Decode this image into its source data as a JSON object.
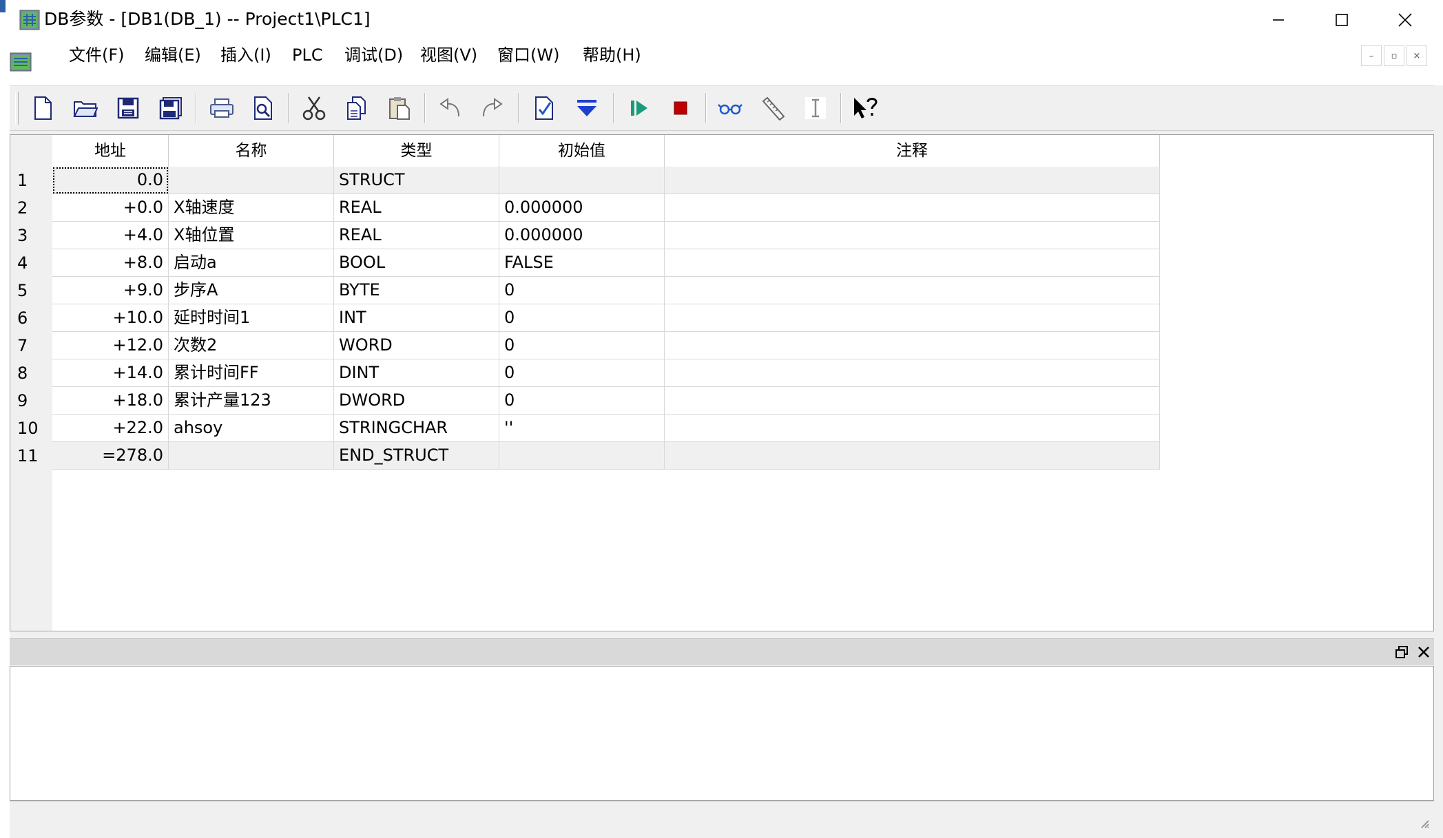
{
  "window": {
    "title": "DB参数 - [DB1(DB_1) -- Project1\\PLC1]",
    "controls": [
      "minimize",
      "maximize",
      "close"
    ]
  },
  "menu": {
    "items": [
      {
        "label": "文件(F)"
      },
      {
        "label": "编辑(E)"
      },
      {
        "label": "插入(I)"
      },
      {
        "label": "PLC"
      },
      {
        "label": "调试(D)"
      },
      {
        "label": "视图(V)"
      },
      {
        "label": "窗口(W)"
      },
      {
        "label": "帮助(H)"
      }
    ],
    "mdi_controls": [
      "–",
      "▫",
      "×"
    ]
  },
  "toolbar": {
    "icons": [
      "new-file-icon",
      "open-folder-icon",
      "save-icon",
      "save-all-icon",
      "print-icon",
      "print-preview-icon",
      "cut-icon",
      "copy-icon",
      "paste-icon",
      "undo-icon",
      "redo-icon",
      "check-icon",
      "download-icon",
      "run-icon",
      "stop-icon",
      "monitor-glasses-icon",
      "ruler-icon",
      "text-cursor-icon",
      "context-help-icon"
    ]
  },
  "grid": {
    "columns": [
      "地址",
      "名称",
      "类型",
      "初始值",
      "注释"
    ],
    "rows": [
      {
        "num": "1",
        "addr": "0.0",
        "name": "",
        "type": "STRUCT",
        "init": "",
        "comment": "",
        "shaded": true
      },
      {
        "num": "2",
        "addr": "+0.0",
        "name": "X轴速度",
        "type": "REAL",
        "init": "0.000000",
        "comment": ""
      },
      {
        "num": "3",
        "addr": "+4.0",
        "name": "X轴位置",
        "type": "REAL",
        "init": "0.000000",
        "comment": ""
      },
      {
        "num": "4",
        "addr": "+8.0",
        "name": "启动a",
        "type": "BOOL",
        "init": "FALSE",
        "comment": ""
      },
      {
        "num": "5",
        "addr": "+9.0",
        "name": "步序A",
        "type": "BYTE",
        "init": "0",
        "comment": ""
      },
      {
        "num": "6",
        "addr": "+10.0",
        "name": "延时时间1",
        "type": "INT",
        "init": "0",
        "comment": ""
      },
      {
        "num": "7",
        "addr": "+12.0",
        "name": "次数2",
        "type": "WORD",
        "init": "0",
        "comment": ""
      },
      {
        "num": "8",
        "addr": "+14.0",
        "name": "累计时间FF",
        "type": "DINT",
        "init": "0",
        "comment": ""
      },
      {
        "num": "9",
        "addr": "+18.0",
        "name": "累计产量123",
        "type": "DWORD",
        "init": "0",
        "comment": ""
      },
      {
        "num": "10",
        "addr": "+22.0",
        "name": "ahsoy",
        "type": "STRINGCHAR",
        "init": "''",
        "comment": ""
      },
      {
        "num": "11",
        "addr": "=278.0",
        "name": "",
        "type": "END_STRUCT",
        "init": "",
        "comment": "",
        "shaded": true
      }
    ]
  },
  "panel": {
    "controls": [
      "restore-panel-icon",
      "close-panel-icon"
    ]
  },
  "colors": {
    "run": "#1a9b7a",
    "stop": "#c00000",
    "download": "#1f3fd1",
    "chrome": "#f0f0f0"
  }
}
